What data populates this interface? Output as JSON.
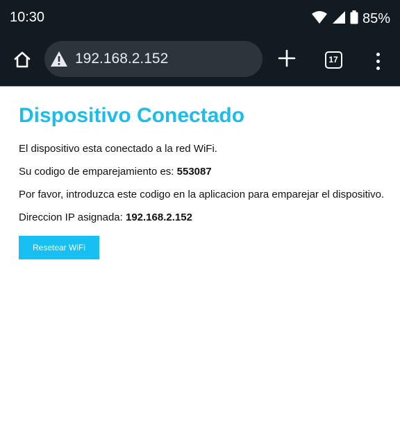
{
  "status_bar": {
    "time": "10:30",
    "battery": "85%",
    "icons": [
      "wifi-icon",
      "signal-icon",
      "battery-icon"
    ]
  },
  "toolbar": {
    "url": "192.168.2.152",
    "tab_count": "17",
    "icons": [
      "home-icon",
      "warning-icon",
      "plus-icon",
      "tabs-icon",
      "menu-icon"
    ]
  },
  "page": {
    "title": "Dispositivo Conectado",
    "line1": "El dispositivo esta conectado a la red WiFi.",
    "pairing_label": "Su codigo de emparejamiento es: ",
    "pairing_code": "553087",
    "line3": "Por favor, introduzca este codigo en la aplicacion para emparejar el dispositivo.",
    "ip_label": "Direccion IP asignada: ",
    "ip_value": "192.168.2.152",
    "reset_button": "Resetear WiFi"
  },
  "colors": {
    "chrome_bg": "#131b22",
    "omnibox_bg": "#2c343c",
    "title": "#1cbcec",
    "button": "#17c0f2"
  }
}
